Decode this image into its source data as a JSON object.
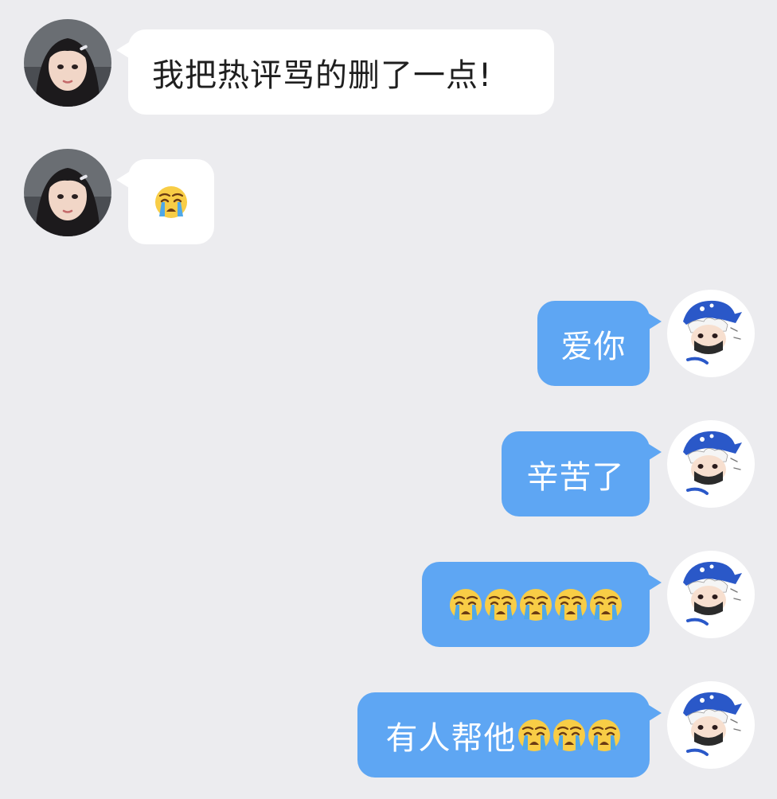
{
  "chat": {
    "messages": [
      {
        "sender": "other",
        "text": "我把热评骂的删了一点!",
        "emoji_count": 0,
        "emoji_name": "loudly-crying-face"
      },
      {
        "sender": "other",
        "text": "",
        "emoji_count": 1,
        "emoji_name": "loudly-crying-face"
      },
      {
        "sender": "me",
        "text": "爱你",
        "emoji_count": 0,
        "emoji_name": "loudly-crying-face"
      },
      {
        "sender": "me",
        "text": "辛苦了",
        "emoji_count": 0,
        "emoji_name": "loudly-crying-face"
      },
      {
        "sender": "me",
        "text": "",
        "emoji_count": 5,
        "emoji_name": "loudly-crying-face"
      },
      {
        "sender": "me",
        "text": "有人帮他",
        "emoji_count": 3,
        "emoji_name": "loudly-crying-face"
      }
    ]
  },
  "colors": {
    "background": "#ececef",
    "incoming_bubble": "#ffffff",
    "outgoing_bubble": "#5ea6f3",
    "outgoing_text": "#ffffff",
    "incoming_text": "#1f1f1f"
  }
}
